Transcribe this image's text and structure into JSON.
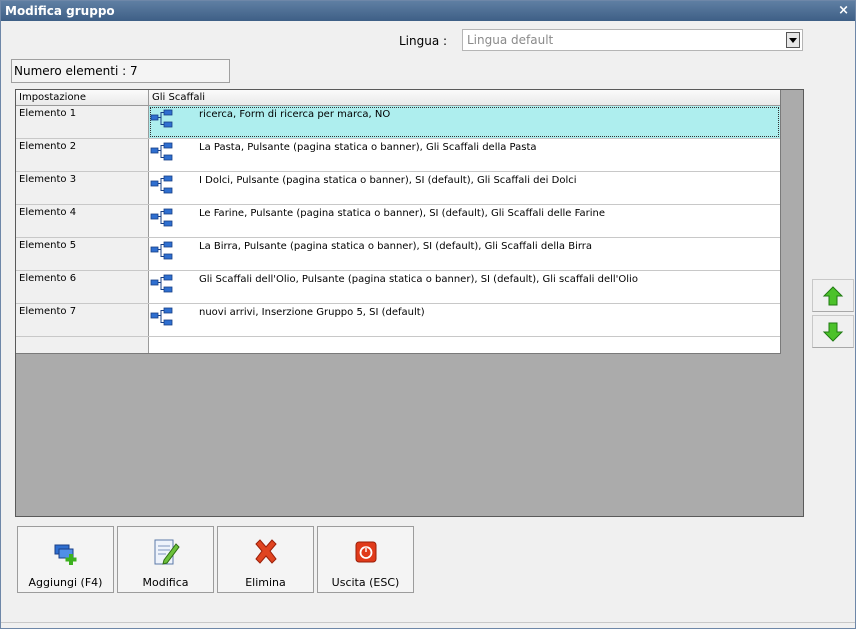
{
  "window": {
    "title": "Modifica gruppo",
    "close_glyph": "×"
  },
  "lingua": {
    "label": "Lingua :",
    "value": "Lingua default"
  },
  "count": {
    "text": "Numero elementi : 7"
  },
  "grid": {
    "headers": [
      "Impostazione",
      "Gli Scaffali"
    ],
    "rows": [
      {
        "label": "Elemento 1",
        "value": "ricerca, Form di ricerca per marca, NO",
        "selected": true
      },
      {
        "label": "Elemento 2",
        "value": "La Pasta, Pulsante (pagina statica o banner), Gli Scaffali della Pasta"
      },
      {
        "label": "Elemento 3",
        "value": "I Dolci, Pulsante (pagina statica o banner), SI (default), Gli Scaffali dei Dolci"
      },
      {
        "label": "Elemento 4",
        "value": "Le Farine, Pulsante (pagina statica o banner), SI (default), Gli Scaffali delle Farine"
      },
      {
        "label": "Elemento 5",
        "value": "La Birra, Pulsante (pagina statica o banner), SI (default), Gli Scaffali della Birra"
      },
      {
        "label": "Elemento 6",
        "value": "Gli Scaffali dell'Olio, Pulsante (pagina statica o banner), SI (default), Gli scaffali dell'Olio"
      },
      {
        "label": "Elemento 7",
        "value": "nuovi arrivi, Inserzione Gruppo 5, SI (default)"
      }
    ],
    "row_icon": "tree-structure-icon",
    "selected_color": "#aeeeee"
  },
  "side_buttons": {
    "up_icon": "arrow-up-icon",
    "down_icon": "arrow-down-icon"
  },
  "toolbar": {
    "add_label": "Aggiungi (F4)",
    "edit_label": "Modifica",
    "delete_label": "Elimina",
    "exit_label": "Uscita (ESC)"
  }
}
